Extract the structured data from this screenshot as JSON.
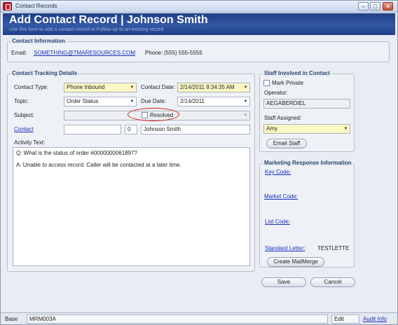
{
  "window": {
    "title": "Contact Records",
    "controls": [
      "–",
      "□",
      "✕"
    ]
  },
  "header": {
    "title": "Add Contact Record  |  Johnson Smith",
    "subtitle": "Use this form to add a contact record or Follow-up to an existing record"
  },
  "contact_info": {
    "legend": "Contact Information",
    "email_label": "Email:",
    "email_value": "SOMETHING@TMARESOURCES.COM",
    "phone_label": "Phone:",
    "phone_value": "(555) 555-5555"
  },
  "tracking": {
    "legend": "Contact Tracking Details",
    "contact_type_label": "Contact Type:",
    "contact_type_value": "Phone Inbound",
    "contact_date_label": "Contact Date:",
    "contact_date_value": "2/14/2011 9:34:35 AM",
    "topic_label": "Topic:",
    "topic_value": "Order Status",
    "due_date_label": "Due Date:",
    "due_date_value": "2/14/2011",
    "subject_label": "Subject:",
    "subject_value": "",
    "resolved_label": "Resolved",
    "contact_link": "Contact",
    "contact_code": "",
    "contact_id": "0",
    "contact_name": "Johnson Smith",
    "activity_label": "Activity Text:",
    "activity_lines": [
      "Q: What is the status of order #0000000061897?",
      "A: Unable to access record. Caller will be contacted at a later time."
    ]
  },
  "staff": {
    "legend": "Staff Involved in Contact",
    "mark_private_label": "Mark Private",
    "operator_label": "Operator:",
    "operator_value": "AEGABERDIEL",
    "staff_assigned_label": "Staff Assigned:",
    "staff_assigned_value": "Amy",
    "email_staff_button": "Email Staff"
  },
  "marketing": {
    "legend": "Marketing Response Information",
    "key_code_label": "Key Code:",
    "market_code_label": "Market Code:",
    "list_code_label": "List Code:",
    "standard_letter_label": "Standard Letter:",
    "standard_letter_value": "TESTLETTE",
    "create_mailmerge_button": "Create MailMerge"
  },
  "actions": {
    "save": "Save",
    "cancel": "Cancel"
  },
  "statusbar": {
    "mode": "Base",
    "form_code": "MRM003A",
    "state": "Edit",
    "audit_link": "Audit Info"
  },
  "colors": {
    "header_blue": "#2a4a96",
    "highlight_yellow": "#fbf7c5",
    "annotation_red": "#d21d1d",
    "link_blue": "#1a2fbf"
  }
}
